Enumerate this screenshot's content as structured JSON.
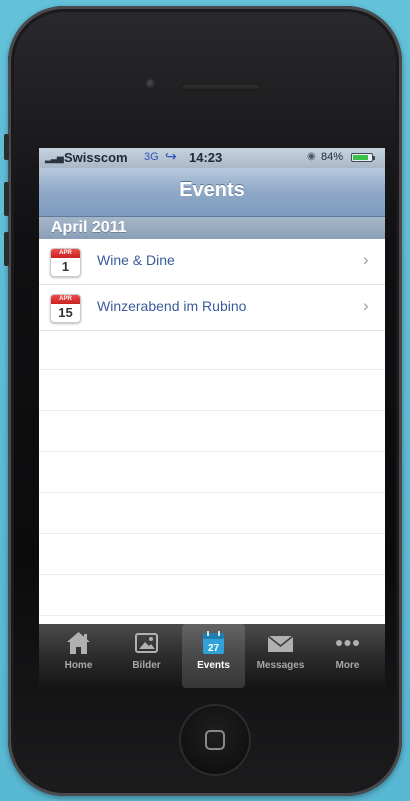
{
  "status_bar": {
    "carrier": "Swisscom",
    "network": "3G",
    "time": "14:23",
    "battery": "84%",
    "battery_level": 0.84
  },
  "nav": {
    "title": "Events"
  },
  "section": {
    "title": "April 2011"
  },
  "events": [
    {
      "month": "APR",
      "day": "1",
      "title": "Wine & Dine"
    },
    {
      "month": "APR",
      "day": "15",
      "title": "Winzerabend im Rubino"
    }
  ],
  "tabs": [
    {
      "label": "Home",
      "icon": "house-icon"
    },
    {
      "label": "Bilder",
      "icon": "picture-icon"
    },
    {
      "label": "Events",
      "icon": "calendar-icon",
      "badge": "27",
      "active": true
    },
    {
      "label": "Messages",
      "icon": "envelope-icon"
    },
    {
      "label": "More",
      "icon": "ellipsis-icon"
    }
  ],
  "colors": {
    "background": "#5fbdd6",
    "nav_bar": "#8fa8c6",
    "list_text": "#3a5b9a",
    "calendar_red": "#d43030",
    "active_tab_icon": "#2fa3d8"
  }
}
